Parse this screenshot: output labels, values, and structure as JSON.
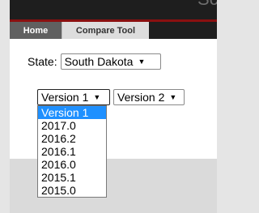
{
  "header": {
    "title": "Screening"
  },
  "tabs": [
    {
      "label": "Home"
    },
    {
      "label": "Compare Tool"
    }
  ],
  "state": {
    "label": "State:",
    "selected": "South Dakota"
  },
  "versions": {
    "version1_selected": "Version 1",
    "version2_selected": "Version 2",
    "options": [
      "Version 1",
      "2017.0",
      "2016.2",
      "2016.1",
      "2016.0",
      "2015.1",
      "2015.0"
    ],
    "highlighted_index": 0
  },
  "icons": {
    "dropdown_arrow": "▼"
  },
  "colors": {
    "highlight": "#1e90ff",
    "header_bg": "#1e1e1e",
    "header_accent": "#8a1010"
  }
}
